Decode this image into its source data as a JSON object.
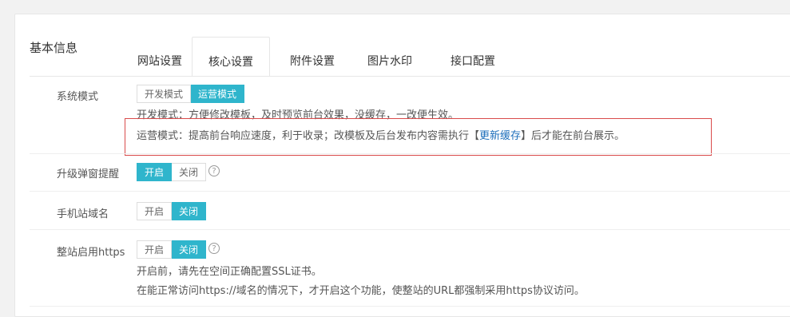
{
  "panel_title": "基本信息",
  "tabs": [
    {
      "label": "网站设置"
    },
    {
      "label": "核心设置"
    },
    {
      "label": "附件设置"
    },
    {
      "label": "图片水印"
    },
    {
      "label": "接口配置"
    }
  ],
  "active_tab": "核心设置",
  "accent_color": "#2fb5cc",
  "highlight_color": "#d94b4b",
  "rows": {
    "system_mode": {
      "label": "系统模式",
      "options": [
        "开发模式",
        "运营模式"
      ],
      "selected": "运营模式",
      "desc_dev": "开发模式：方便修改模板，及时预览前台效果，没缓存，一改便生效。",
      "desc_ops_prefix": "运营模式：提高前台响应速度，利于收录；改模板及后台发布内容需执行【",
      "desc_ops_link": "更新缓存",
      "desc_ops_suffix": "】后才能在前台展示。"
    },
    "upgrade_popup": {
      "label": "升级弹窗提醒",
      "options": [
        "开启",
        "关闭"
      ],
      "selected": "开启",
      "help_icon": "question-circle-icon"
    },
    "mobile_domain": {
      "label": "手机站域名",
      "options": [
        "开启",
        "关闭"
      ],
      "selected": "关闭"
    },
    "https": {
      "label": "整站启用https",
      "options": [
        "开启",
        "关闭"
      ],
      "selected": "关闭",
      "help_icon": "question-circle-icon",
      "desc_1": "开启前，请先在空间正确配置SSL证书。",
      "desc_2": "在能正常访问https://域名的情况下，才开启这个功能，使整站的URL都强制采用https协议访问。"
    }
  }
}
